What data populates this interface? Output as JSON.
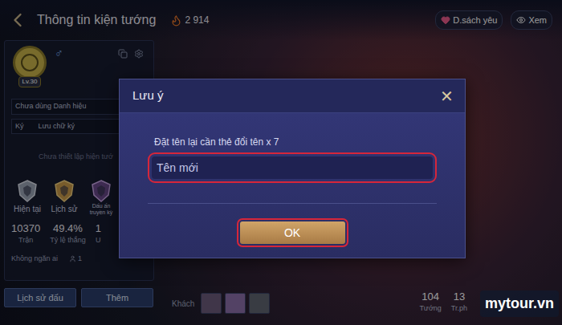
{
  "top_bar": {
    "title": "Thông tin kiện tướng",
    "fire_count": "2 914",
    "favorites": "D.sách yêu",
    "view": "Xem"
  },
  "profile": {
    "level": "Lv.30",
    "gender": "♂",
    "title_badge": "Chưa dùng Danh hiệu",
    "signature_label": "Ký",
    "signature_value": "Lưu chữ ký",
    "hero_display": "Chưa thiết lập hiện tướ"
  },
  "ranks": [
    {
      "label": "Hiện tại"
    },
    {
      "label": "Lịch sử"
    },
    {
      "label": "Dấu ấn truyền kỳ"
    }
  ],
  "stats": [
    {
      "value": "10370",
      "label": "Trận"
    },
    {
      "value": "49.4%",
      "label": "Tỷ lệ thắng"
    },
    {
      "value": "1",
      "label": "U"
    }
  ],
  "block": {
    "label": "Không ngăn ai",
    "count": "1"
  },
  "buttons": [
    "Lịch sử đấu",
    "Thêm"
  ],
  "visitors": {
    "label": "Khách",
    "avatars": [
      {
        "color": "#6b5a7a"
      },
      {
        "color": "#8a6fa8"
      },
      {
        "color": "#5f6470"
      }
    ]
  },
  "hero_stats": [
    {
      "value": "104",
      "label": "Tướng"
    },
    {
      "value": "13",
      "label": "Tr.ph"
    }
  ],
  "dialog": {
    "title": "Lưu ý",
    "close": "✕",
    "message": "Đặt tên lại cần thẻ đổi tên x 7",
    "input_placeholder": "Tên mới",
    "ok": "OK"
  },
  "watermark": "mytour.vn"
}
